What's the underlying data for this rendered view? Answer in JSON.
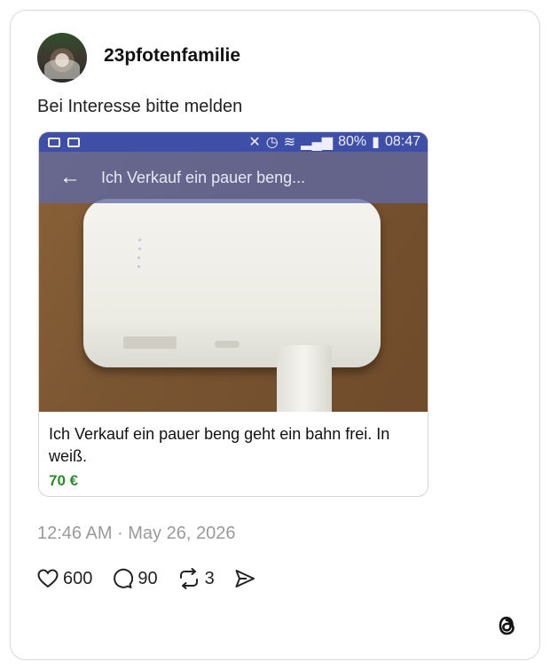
{
  "post": {
    "username": "23pfotenfamilie",
    "text": "Bei Interesse bitte melden",
    "timestamp": "12:46 AM · May 26, 2026"
  },
  "embed": {
    "statusbar": {
      "battery": "80%",
      "time": "08:47"
    },
    "appbar_title": "Ich Verkauf ein pauer beng...",
    "listing_title": "Ich Verkauf ein pauer beng geht ein bahn frei. In weiß.",
    "price": "70 €"
  },
  "actions": {
    "likes": "600",
    "replies": "90",
    "reposts": "3"
  },
  "colors": {
    "price": "#2e8b2e",
    "statusbar": "#3f4fa8",
    "timestamp": "#9a9a9a"
  }
}
